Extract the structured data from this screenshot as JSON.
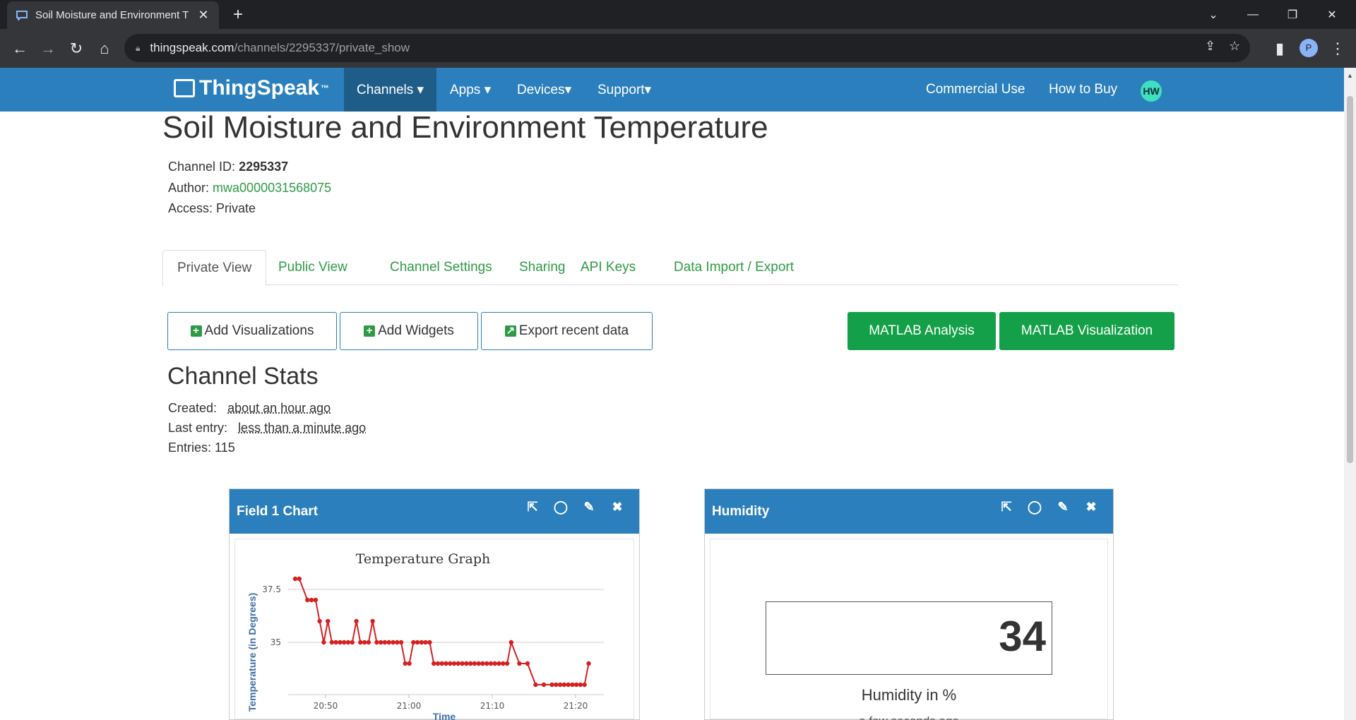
{
  "browser": {
    "tab_title": "Soil Moisture and Environment T",
    "url_host": "thingspeak.com",
    "url_path": "/channels/2295337/private_show",
    "profile_initial": "P"
  },
  "nav": {
    "logo": "ThingSpeak",
    "logo_tm": "™",
    "items": [
      "Channels ▾",
      "Apps ▾",
      "Devices▾",
      "Support▾"
    ],
    "right": [
      "Commercial Use",
      "How to Buy"
    ],
    "avatar": "HW"
  },
  "channel": {
    "title": "Soil Moisture and Environment Temperature",
    "id_label": "Channel ID: ",
    "id": "2295337",
    "author_label": "Author: ",
    "author": "mwa0000031568075",
    "access": "Access: Private"
  },
  "tabs": [
    "Private View",
    "Public View",
    "Channel Settings",
    "Sharing",
    "API Keys",
    "Data Import / Export"
  ],
  "buttons": {
    "add_viz": "Add Visualizations",
    "add_widgets": "Add Widgets",
    "export": "Export recent data",
    "matlab_analysis": "MATLAB Analysis",
    "matlab_viz": "MATLAB Visualization"
  },
  "stats": {
    "heading": "Channel Stats",
    "created_label": "Created:",
    "created": "about an hour ago",
    "last_label": "Last entry:",
    "last": "less than a minute ago",
    "entries": "Entries: 115"
  },
  "field1": {
    "header": "Field 1 Chart"
  },
  "humidity": {
    "header": "Humidity",
    "value": "34",
    "label": "Humidity in %",
    "sub": "a few seconds ago"
  },
  "chart_data": {
    "type": "line",
    "title": "Temperature Graph",
    "xlabel": "Time",
    "ylabel": "Temperature (in Degrees)",
    "color": "#d62020",
    "x_ticks": [
      "20:50",
      "21:00",
      "21:10",
      "21:20"
    ],
    "y_ticks": [
      37.5,
      35
    ],
    "x_range_minutes": [
      20.5,
      57.5
    ],
    "ylim": [
      32.7,
      38.2
    ],
    "x_minutes": [
      20.5,
      21,
      22,
      22.5,
      23,
      23.5,
      24,
      24.5,
      25,
      25.5,
      26,
      26.5,
      27,
      27.5,
      28,
      28.5,
      29,
      29.5,
      30,
      30.5,
      31,
      31.5,
      32,
      32.5,
      33,
      33.5,
      34,
      34.5,
      35,
      35.5,
      36,
      36.5,
      37,
      37.5,
      38,
      38.5,
      39,
      39.5,
      40,
      40.5,
      41,
      41.5,
      42,
      42.5,
      43,
      43.5,
      44,
      44.5,
      45,
      45.5,
      46,
      46.5,
      47,
      48,
      49,
      50,
      51,
      52,
      52.5,
      53,
      53.5,
      54,
      54.5,
      55,
      55.5,
      56,
      56.5
    ],
    "values": [
      38,
      38,
      37,
      37,
      37,
      36,
      35,
      36,
      35,
      35,
      35,
      35,
      35,
      35,
      36,
      35,
      35,
      35,
      36,
      35,
      35,
      35,
      35,
      35,
      35,
      35,
      34,
      34,
      35,
      35,
      35,
      35,
      35,
      34,
      34,
      34,
      34,
      34,
      34,
      34,
      34,
      34,
      34,
      34,
      34,
      34,
      34,
      34,
      34,
      34,
      34,
      34,
      35,
      34,
      34,
      33,
      33,
      33,
      33,
      33,
      33,
      33,
      33,
      33,
      33,
      33,
      34
    ]
  }
}
